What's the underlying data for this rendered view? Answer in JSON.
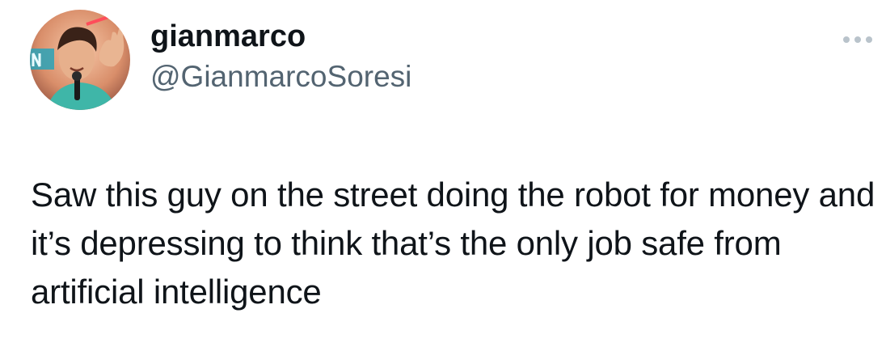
{
  "author": {
    "display_name": "gianmarco",
    "handle": "@GianmarcoSoresi",
    "avatar_icon": "profile-photo"
  },
  "menu": {
    "icon": "more-horizontal-icon"
  },
  "tweet": {
    "text": "Saw this guy on the street doing the robot for money and it’s depressing to think that’s the only job safe from artificial intelligence"
  },
  "colors": {
    "text_primary": "#0f1419",
    "text_secondary": "#536471",
    "background": "#ffffff"
  }
}
